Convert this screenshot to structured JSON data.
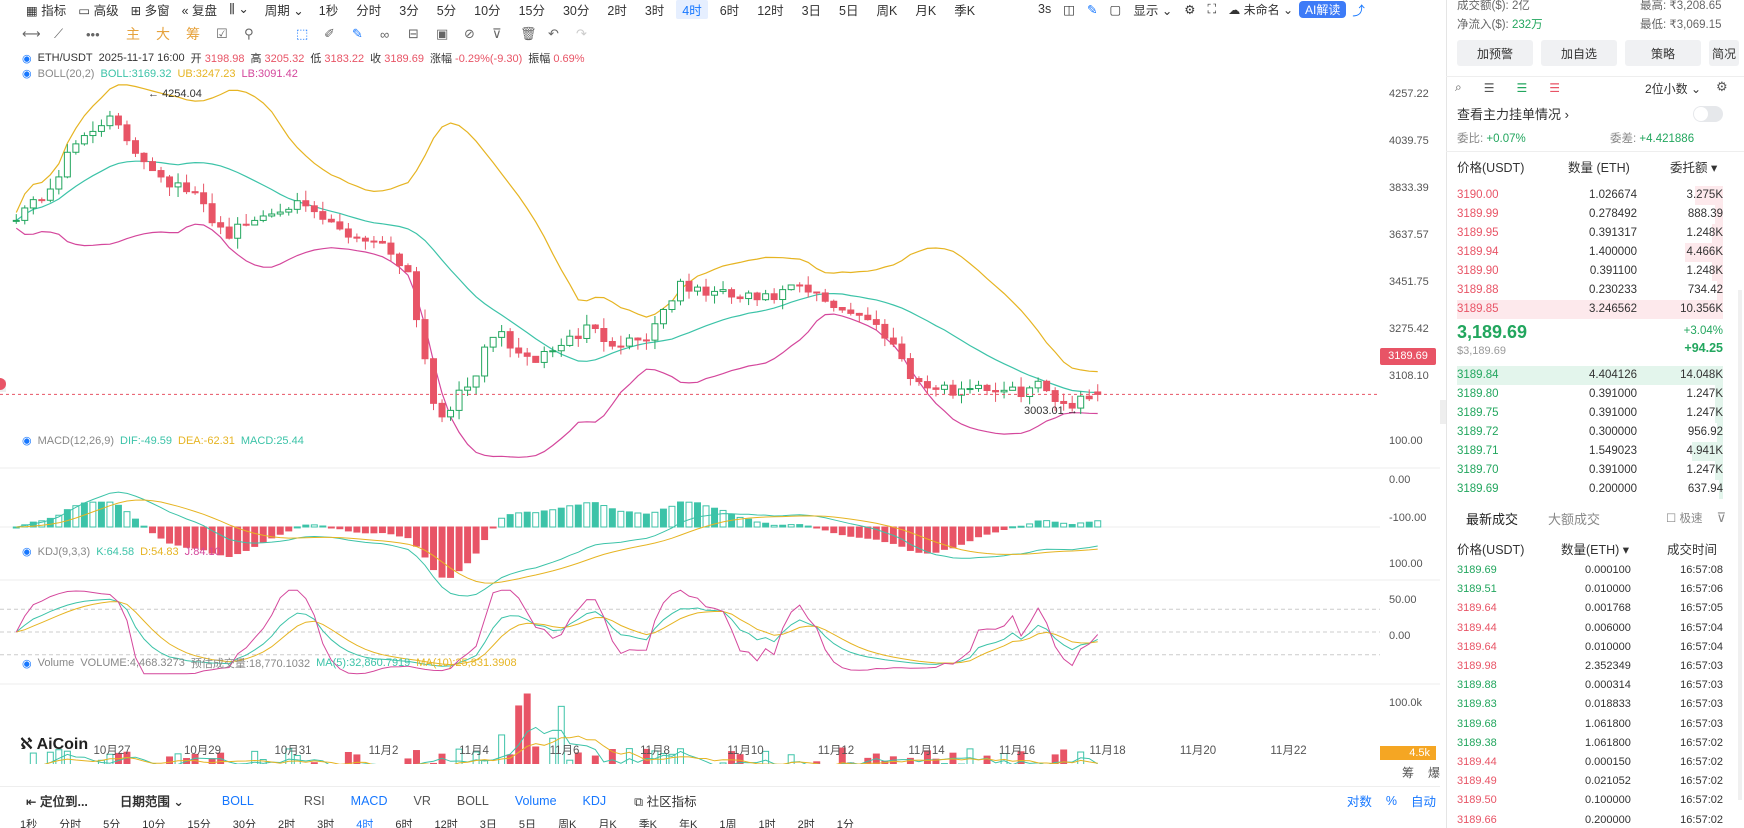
{
  "colors": {
    "up": "#22a65e",
    "down": "#e85466",
    "blue": "#1677ff",
    "mb": "#3cc3a8",
    "ub": "#e6b422",
    "lb": "#d4479c"
  },
  "toolbar": {
    "indicators": "指标",
    "advanced": "高级",
    "multi_window": "多窗",
    "replay": "复盘",
    "period_label": "周期",
    "periods": [
      "1秒",
      "分时",
      "3分",
      "5分",
      "10分",
      "15分",
      "30分",
      "2时",
      "3时",
      "4时",
      "6时",
      "12时",
      "3日",
      "5日",
      "周K",
      "月K",
      "季K"
    ],
    "active_period": "4时",
    "refresh": "3s",
    "display": "显示",
    "unnamed": "未命名",
    "ai": "AI解读"
  },
  "draw_toolbar": {
    "main": "主",
    "big": "大",
    "chip": "筹"
  },
  "legend": {
    "pair": "ETH/USDT",
    "time": "2025-11-17 16:00",
    "open_label": "开",
    "open": "3198.98",
    "high_label": "高",
    "high": "3205.32",
    "low_label": "低",
    "low": "3183.22",
    "close_label": "收",
    "close": "3189.69",
    "chg_label": "涨幅",
    "chg": "-0.29%(-9.30)",
    "amp_label": "振幅",
    "amp": "0.69%",
    "boll_name": "BOLL(20,2)",
    "boll": "BOLL:3169.32",
    "ub": "UB:3247.23",
    "lb": "LB:3091.42",
    "macd_name": "MACD(12,26,9)",
    "dif": "DIF:-49.59",
    "dea": "DEA:-62.31",
    "macd": "MACD:25.44",
    "kdj_name": "KDJ(9,3,3)",
    "k": "K:64.58",
    "d": "D:54.83",
    "j": "J:84.10",
    "vol_name": "Volume",
    "vol": "VOLUME:4,468.3273",
    "est": "预估成交量:18,770.1032",
    "ma5": "MA(5):32,860.7919",
    "ma10": "MA(10):25,831.3908"
  },
  "axes": {
    "price": [
      "4257.22",
      "4039.75",
      "3833.39",
      "3637.57",
      "3451.75",
      "3275.42",
      "3108.10"
    ],
    "macd": [
      "100.00",
      "0.00",
      "-100.00"
    ],
    "kdj": [
      "100.00",
      "50.00",
      "0.00"
    ],
    "volume": [
      "100.0k"
    ],
    "vol_tag": "4.5k",
    "current_price_tag": "3189.69",
    "dates": [
      "10月27",
      "10月29",
      "10月31",
      "11月2",
      "11月4",
      "11月6",
      "11月8",
      "11月10",
      "11月12",
      "11月14",
      "11月16",
      "11月18",
      "11月20",
      "11月22"
    ],
    "high_mark": "4254.04",
    "low_mark": "3003.01",
    "bottom_right": [
      "筹",
      "爆"
    ]
  },
  "chart_data": {
    "type": "candlestick",
    "symbol": "ETH/USDT",
    "interval": "4H",
    "ohlc_last": {
      "open": 3198.98,
      "high": 3205.32,
      "low": 3183.22,
      "close": 3189.69
    },
    "price_range": [
      3000,
      4300
    ],
    "extremes": {
      "high": 4254.04,
      "low": 3003.01
    },
    "control_closes": [
      3880,
      3955,
      4150,
      4254,
      4120,
      4010,
      3940,
      3800,
      3860,
      3925,
      3870,
      3800,
      3780,
      3680,
      3100,
      3210,
      3440,
      3310,
      3370,
      3440,
      3390,
      3410,
      3600,
      3580,
      3560,
      3550,
      3600,
      3540,
      3500,
      3420,
      3230,
      3200,
      3230,
      3190,
      3225,
      3150,
      3189.69
    ],
    "boll": {
      "mid": 3169.32,
      "ub": 3247.23,
      "lb": 3091.42
    },
    "macd": {
      "dif": -49.59,
      "dea": -62.31,
      "macd": 25.44,
      "range": [
        -120,
        120
      ]
    },
    "kdj": {
      "k": 64.58,
      "d": 54.83,
      "j": 84.1,
      "range": [
        0,
        100
      ]
    },
    "volume": {
      "last": 4468.3273,
      "estimate": 18770.1032,
      "ma5": 32860.7919,
      "ma10": 25831.3908
    }
  },
  "bottom_bar": {
    "locate": "定位到...",
    "date_range": "日期范围",
    "boll": "BOLL",
    "indicators": [
      "RSI",
      "MACD",
      "VR",
      "BOLL",
      "Volume",
      "KDJ"
    ],
    "community": "社区指标",
    "log": "对数",
    "pct": "%",
    "auto": "自动",
    "periods": [
      "1秒",
      "分时",
      "5分",
      "10分",
      "15分",
      "30分",
      "2时",
      "3时",
      "4时",
      "6时",
      "12时",
      "3日",
      "5日",
      "周K",
      "月K",
      "季K",
      "年K",
      "1周",
      "1时",
      "2时",
      "1分"
    ]
  },
  "panel": {
    "top_left": [
      "成交额($):",
      "净流入($):"
    ],
    "top_left_vals": [
      "2亿",
      "232万"
    ],
    "top_right": [
      "最高:",
      "最低:"
    ],
    "top_right_vals": [
      "₹3,208.65",
      "₹3,069.15"
    ],
    "buttons": [
      "加预警",
      "加自选",
      "策略",
      "简况"
    ],
    "precision": "2位小数",
    "whale_title": "查看主力挂单情况",
    "ratio_label": "委比:",
    "ratio": "+0.07%",
    "diff_label": "委差:",
    "diff": "+4.421886",
    "ob_headers": [
      "价格(USDT)",
      "数量 (ETH)",
      "委托额"
    ],
    "asks": [
      [
        "3190.00",
        "1.026674",
        "3.275K"
      ],
      [
        "3189.99",
        "0.278492",
        "888.39"
      ],
      [
        "3189.95",
        "0.391317",
        "1.248K"
      ],
      [
        "3189.94",
        "1.400000",
        "4.466K"
      ],
      [
        "3189.90",
        "0.391100",
        "1.248K"
      ],
      [
        "3189.88",
        "0.230233",
        "734.42"
      ],
      [
        "3189.85",
        "3.246562",
        "10.356K"
      ]
    ],
    "ask_depth": [
      0.32,
      0.09,
      0.12,
      0.43,
      0.12,
      0.07,
      1.0
    ],
    "last_price": "3,189.69",
    "last_usd": "$3,189.69",
    "chg_pct": "+3.04%",
    "chg_abs": "+94.25",
    "bids": [
      [
        "3189.84",
        "4.404126",
        "14.048K"
      ],
      [
        "3189.80",
        "0.391000",
        "1.247K"
      ],
      [
        "3189.75",
        "0.391000",
        "1.247K"
      ],
      [
        "3189.72",
        "0.300000",
        "956.92"
      ],
      [
        "3189.71",
        "1.549023",
        "4.941K"
      ],
      [
        "3189.70",
        "0.391000",
        "1.247K"
      ],
      [
        "3189.69",
        "0.200000",
        "637.94"
      ]
    ],
    "bid_depth": [
      1.0,
      0.09,
      0.09,
      0.07,
      0.35,
      0.09,
      0.05
    ],
    "tabs": [
      "最新成交",
      "大额成交"
    ],
    "fast": "极速",
    "trade_headers": [
      "价格(USDT)",
      "数量(ETH)",
      "成交时间"
    ],
    "trades": [
      [
        "3189.69",
        "0.000100",
        "16:57:08",
        "up"
      ],
      [
        "3189.51",
        "0.010000",
        "16:57:06",
        "up"
      ],
      [
        "3189.64",
        "0.001768",
        "16:57:05",
        "down"
      ],
      [
        "3189.44",
        "0.006000",
        "16:57:04",
        "down"
      ],
      [
        "3189.64",
        "0.010000",
        "16:57:04",
        "down"
      ],
      [
        "3189.98",
        "2.352349",
        "16:57:03",
        "down"
      ],
      [
        "3189.88",
        "0.000314",
        "16:57:03",
        "up"
      ],
      [
        "3189.83",
        "0.018833",
        "16:57:03",
        "up"
      ],
      [
        "3189.68",
        "1.061800",
        "16:57:03",
        "up"
      ],
      [
        "3189.38",
        "1.061800",
        "16:57:02",
        "up"
      ],
      [
        "3189.44",
        "0.000150",
        "16:57:02",
        "down"
      ],
      [
        "3189.49",
        "0.021052",
        "16:57:02",
        "down"
      ],
      [
        "3189.50",
        "0.100000",
        "16:57:02",
        "down"
      ],
      [
        "3189.66",
        "0.200000",
        "16:57:02",
        "down"
      ]
    ]
  },
  "brand": "AiCoin"
}
